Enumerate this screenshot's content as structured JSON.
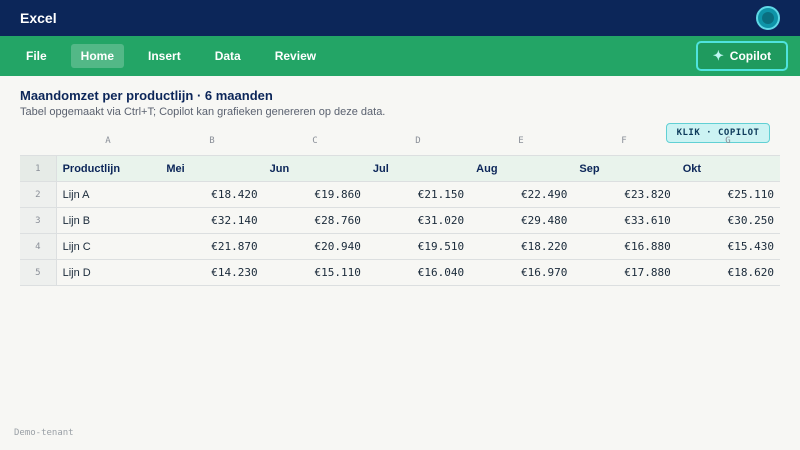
{
  "window": {
    "title": "Excel"
  },
  "ribbon": {
    "tabs": [
      {
        "label": "File",
        "active": false
      },
      {
        "label": "Home",
        "active": true
      },
      {
        "label": "Insert",
        "active": false
      },
      {
        "label": "Data",
        "active": false
      },
      {
        "label": "Review",
        "active": false
      }
    ],
    "copilot_label": "Copilot",
    "copilot_icon": "sparkle-icon"
  },
  "content": {
    "heading": "Maandomzet per productlijn · 6 maanden",
    "subheading": "Tabel opgemaakt via Ctrl+T; Copilot kan grafieken genereren op deze data.",
    "hint_badge": "KLIK · COPILOT"
  },
  "sheet": {
    "column_letters": [
      "A",
      "B",
      "C",
      "D",
      "E",
      "F",
      "G"
    ],
    "row_numbers": [
      "1",
      "2",
      "3",
      "4",
      "5"
    ],
    "header": [
      "Productlijn",
      "Mei",
      "Jun",
      "Jul",
      "Aug",
      "Sep",
      "Okt"
    ],
    "rows": [
      [
        "Lijn A",
        "€18.420",
        "€19.860",
        "€21.150",
        "€22.490",
        "€23.820",
        "€25.110"
      ],
      [
        "Lijn B",
        "€32.140",
        "€28.760",
        "€31.020",
        "€29.480",
        "€33.610",
        "€30.250"
      ],
      [
        "Lijn C",
        "€21.870",
        "€20.940",
        "€19.510",
        "€18.220",
        "€16.880",
        "€15.430"
      ],
      [
        "Lijn D",
        "€14.230",
        "€15.110",
        "€16.040",
        "€16.970",
        "€17.880",
        "€18.620"
      ]
    ]
  },
  "footer": {
    "tenant": "Demo-tenant"
  },
  "colors": {
    "titlebar": "#0c2659",
    "ribbon": "#23a566",
    "accent": "#4fe3de"
  }
}
